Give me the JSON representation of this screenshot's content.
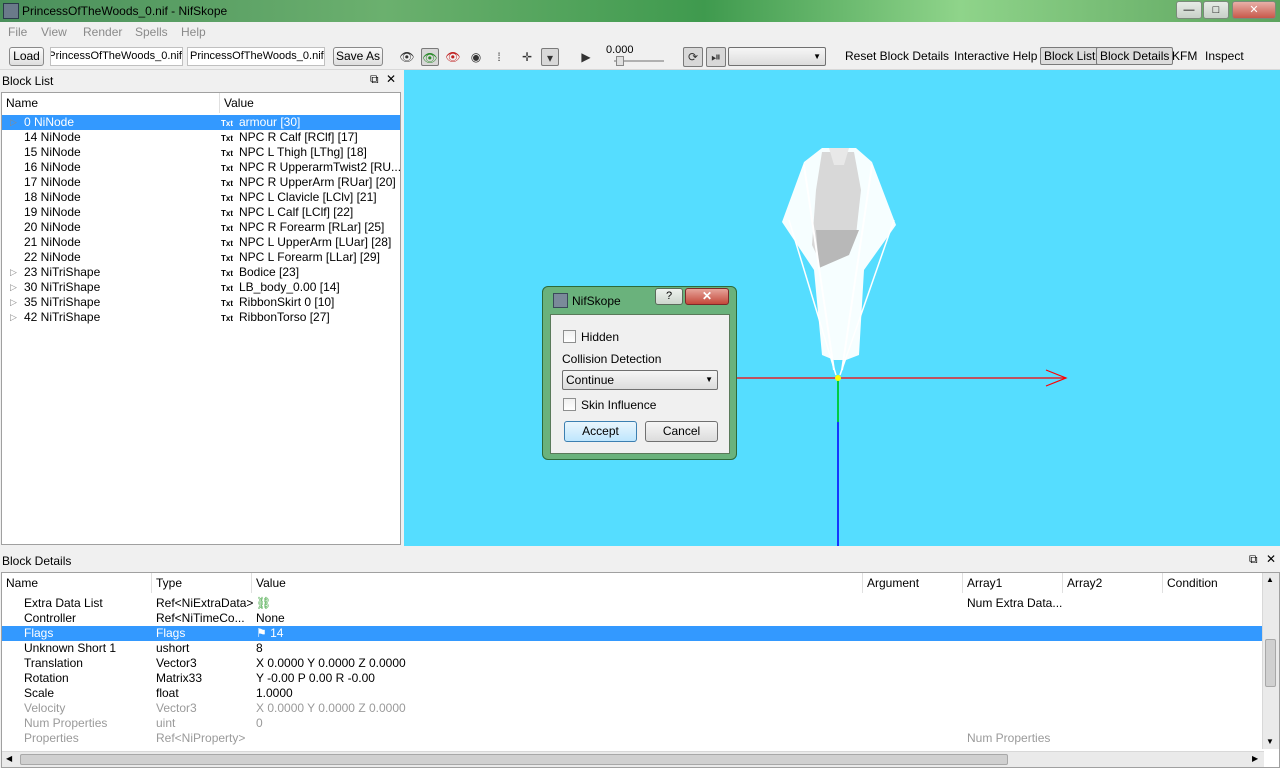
{
  "window": {
    "title": "PrincessOfTheWoods_0.nif - NifSkope",
    "minimize": "—",
    "maximize": "□",
    "close": "✕"
  },
  "menu": [
    "File",
    "View",
    "Render",
    "Spells",
    "Help"
  ],
  "toolbar": {
    "load": "Load",
    "load_path": "PrincessOfTheWoods_0.nif",
    "save_path": "PrincessOfTheWoods_0.nif",
    "save_as": "Save As",
    "time_value": "0.000",
    "links": {
      "reset_block_details": "Reset Block Details",
      "interactive_help": "Interactive Help",
      "block_list": "Block List",
      "block_details": "Block Details",
      "kfm": "KFM",
      "inspect": "Inspect"
    }
  },
  "block_list": {
    "title": "Block List",
    "headers": {
      "name": "Name",
      "value": "Value"
    },
    "rows": [
      {
        "name": "0 NiNode",
        "txt": "Txt",
        "value": "armour [30]",
        "expand": "▷"
      },
      {
        "name": "14 NiNode",
        "txt": "Txt",
        "value": "NPC R Calf [RClf] [17]",
        "expand": ""
      },
      {
        "name": "15 NiNode",
        "txt": "Txt",
        "value": "NPC L Thigh [LThg] [18]",
        "expand": ""
      },
      {
        "name": "16 NiNode",
        "txt": "Txt",
        "value": "NPC R UpperarmTwist2 [RU...",
        "expand": ""
      },
      {
        "name": "17 NiNode",
        "txt": "Txt",
        "value": "NPC R UpperArm [RUar] [20]",
        "expand": ""
      },
      {
        "name": "18 NiNode",
        "txt": "Txt",
        "value": "NPC L Clavicle [LClv] [21]",
        "expand": ""
      },
      {
        "name": "19 NiNode",
        "txt": "Txt",
        "value": "NPC L Calf [LClf] [22]",
        "expand": ""
      },
      {
        "name": "20 NiNode",
        "txt": "Txt",
        "value": "NPC R Forearm [RLar] [25]",
        "expand": ""
      },
      {
        "name": "21 NiNode",
        "txt": "Txt",
        "value": "NPC L UpperArm [LUar] [28]",
        "expand": ""
      },
      {
        "name": "22 NiNode",
        "txt": "Txt",
        "value": "NPC L Forearm [LLar] [29]",
        "expand": ""
      },
      {
        "name": "23 NiTriShape",
        "txt": "Txt",
        "value": "Bodice [23]",
        "expand": "▷"
      },
      {
        "name": "30 NiTriShape",
        "txt": "Txt",
        "value": "LB_body_0.00 [14]",
        "expand": "▷"
      },
      {
        "name": "35 NiTriShape",
        "txt": "Txt",
        "value": "RibbonSkirt 0 [10]",
        "expand": "▷"
      },
      {
        "name": "42 NiTriShape",
        "txt": "Txt",
        "value": "RibbonTorso [27]",
        "expand": "▷"
      }
    ]
  },
  "dialog": {
    "title": "NifSkope",
    "help": "?",
    "close": "✕",
    "hidden_label": "Hidden",
    "collision_label": "Collision Detection",
    "collision_value": "Continue",
    "skin_label": "Skin Influence",
    "accept": "Accept",
    "cancel": "Cancel"
  },
  "block_details": {
    "title": "Block Details",
    "headers": {
      "name": "Name",
      "type": "Type",
      "value": "Value",
      "argument": "Argument",
      "array1": "Array1",
      "array2": "Array2",
      "condition": "Condition"
    },
    "rows": [
      {
        "name": "Extra Data List",
        "type": "Ref<NiExtraData>",
        "value": "",
        "array1": "Num Extra Data..."
      },
      {
        "name": "Controller",
        "type": "Ref<NiTimeCo...",
        "value": "None",
        "array1": ""
      },
      {
        "name": "Flags",
        "type": "Flags",
        "value": "14",
        "array1": ""
      },
      {
        "name": "Unknown Short 1",
        "type": "ushort",
        "value": "8",
        "array1": ""
      },
      {
        "name": "Translation",
        "type": "Vector3",
        "value": "X 0.0000 Y 0.0000 Z 0.0000",
        "array1": ""
      },
      {
        "name": "Rotation",
        "type": "Matrix33",
        "value": "Y -0.00 P 0.00 R -0.00",
        "array1": ""
      },
      {
        "name": "Scale",
        "type": "float",
        "value": "1.0000",
        "array1": ""
      },
      {
        "name": "Velocity",
        "type": "Vector3",
        "value": "X 0.0000 Y 0.0000 Z 0.0000",
        "array1": ""
      },
      {
        "name": "Num Properties",
        "type": "uint",
        "value": "0",
        "array1": ""
      },
      {
        "name": "Properties",
        "type": "Ref<NiProperty>",
        "value": "",
        "array1": "Num Properties"
      }
    ]
  },
  "colors": {
    "selection": "#3399ff",
    "viewport_bg": "#55ddff",
    "axis_x": "#ff0000",
    "axis_y": "#00cc44",
    "axis_z": "#0000ff"
  }
}
